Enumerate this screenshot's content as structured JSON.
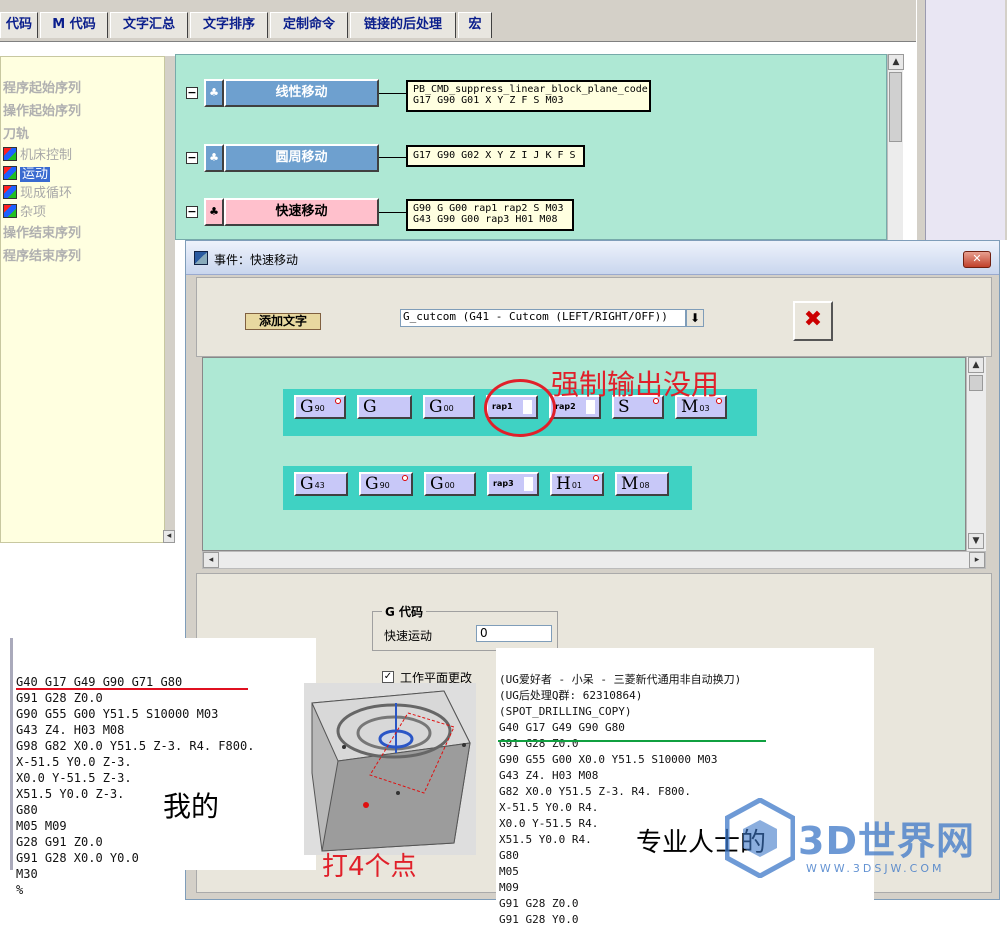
{
  "tabs": [
    "代码",
    "M 代码",
    "文字汇总",
    "文字排序",
    "定制命令",
    "链接的后处理",
    "宏"
  ],
  "tree": {
    "items": [
      "程序起始序列",
      "操作起始序列",
      "刀轨"
    ],
    "leaves": [
      "机床控制",
      "运动",
      "现成循环",
      "杂项"
    ],
    "items_after": [
      "操作结束序列",
      "程序结束序列"
    ]
  },
  "events": [
    {
      "name": "线性移动",
      "code": "PB_CMD_suppress_linear_block_plane_code\nG17 G90 G01 X Y Z F S M03"
    },
    {
      "name": "圆周移动",
      "code": "G17 G90 G02 X Y Z I J K F S"
    },
    {
      "name": "快速移动",
      "code": "G90 G G00 rap1 rap2 S M03\nG43 G90 G00 rap3 H01 M08"
    }
  ],
  "dialog": {
    "title": "事件：快速移动",
    "add_text_label": "添加文字",
    "combo_value": "G_cutcom (G41 - Cutcom (LEFT/RIGHT/OFF))",
    "combo_arrow": "⬇",
    "trash_icon": "✖",
    "close_icon": "✕",
    "row1": [
      {
        "letter": "G",
        "sub": "90",
        "dot": true
      },
      {
        "letter": "G",
        "sub": "",
        "dot": false
      },
      {
        "letter": "G",
        "sub": "00",
        "dot": false
      },
      {
        "letter": "rap1",
        "sub": "",
        "dot": false,
        "small": true
      },
      {
        "letter": "rap2",
        "sub": "",
        "dot": false,
        "small": true
      },
      {
        "letter": "S",
        "sub": "",
        "dot": true
      },
      {
        "letter": "M",
        "sub": "03",
        "dot": true
      }
    ],
    "row2": [
      {
        "letter": "G",
        "sub": "43",
        "dot": false
      },
      {
        "letter": "G",
        "sub": "90",
        "dot": true
      },
      {
        "letter": "G",
        "sub": "00",
        "dot": false
      },
      {
        "letter": "rap3",
        "sub": "",
        "dot": false,
        "small": true
      },
      {
        "letter": "H",
        "sub": "01",
        "dot": true
      },
      {
        "letter": "M",
        "sub": "08",
        "dot": false
      }
    ],
    "annotation": "强制输出没用",
    "group_title": "G 代码",
    "rapid_label": "快速运动",
    "rapid_value": "0",
    "checkbox_label": "工作平面更改"
  },
  "listing_mine": [
    "G40 G17 G49 G90 G71 G80",
    "G91 G28 Z0.0",
    "G90 G55 G00 Y51.5 S10000 M03",
    "G43 Z4. H03 M08",
    "G98 G82 X0.0 Y51.5 Z-3. R4. F800.",
    "X-51.5 Y0.0 Z-3.",
    "X0.0 Y-51.5 Z-3.",
    "X51.5 Y0.0 Z-3.",
    "G80",
    "M05 M09",
    "G28 G91 Z0.0",
    "G91 G28 X0.0 Y0.0",
    "M30",
    "%"
  ],
  "label_mine": "我的",
  "label_points": "打4个点",
  "listing_pro": [
    "(UG爱好者 - 小呆 - 三菱新代通用非自动换刀)",
    "(UG后处理Q群: 62310864)",
    "(SPOT_DRILLING_COPY)",
    "G40 G17 G49 G90 G80",
    "G91 G28 Z0.0",
    "G90 G55 G00 X0.0 Y51.5 S10000 M03",
    "G43 Z4. H03 M08",
    "G82 X0.0 Y51.5 Z-3. R4. F800.",
    "X-51.5 Y0.0 R4.",
    "X0.0 Y-51.5 R4.",
    "X51.5 Y0.0 R4.",
    "G80",
    "M05",
    "M09",
    "G91 G28 Z0.0",
    "G91 G28 Y0.0"
  ],
  "label_pro": "专业人士的",
  "watermark": {
    "brand": "3D世界网",
    "url": "WWW.3DSJW.COM"
  }
}
